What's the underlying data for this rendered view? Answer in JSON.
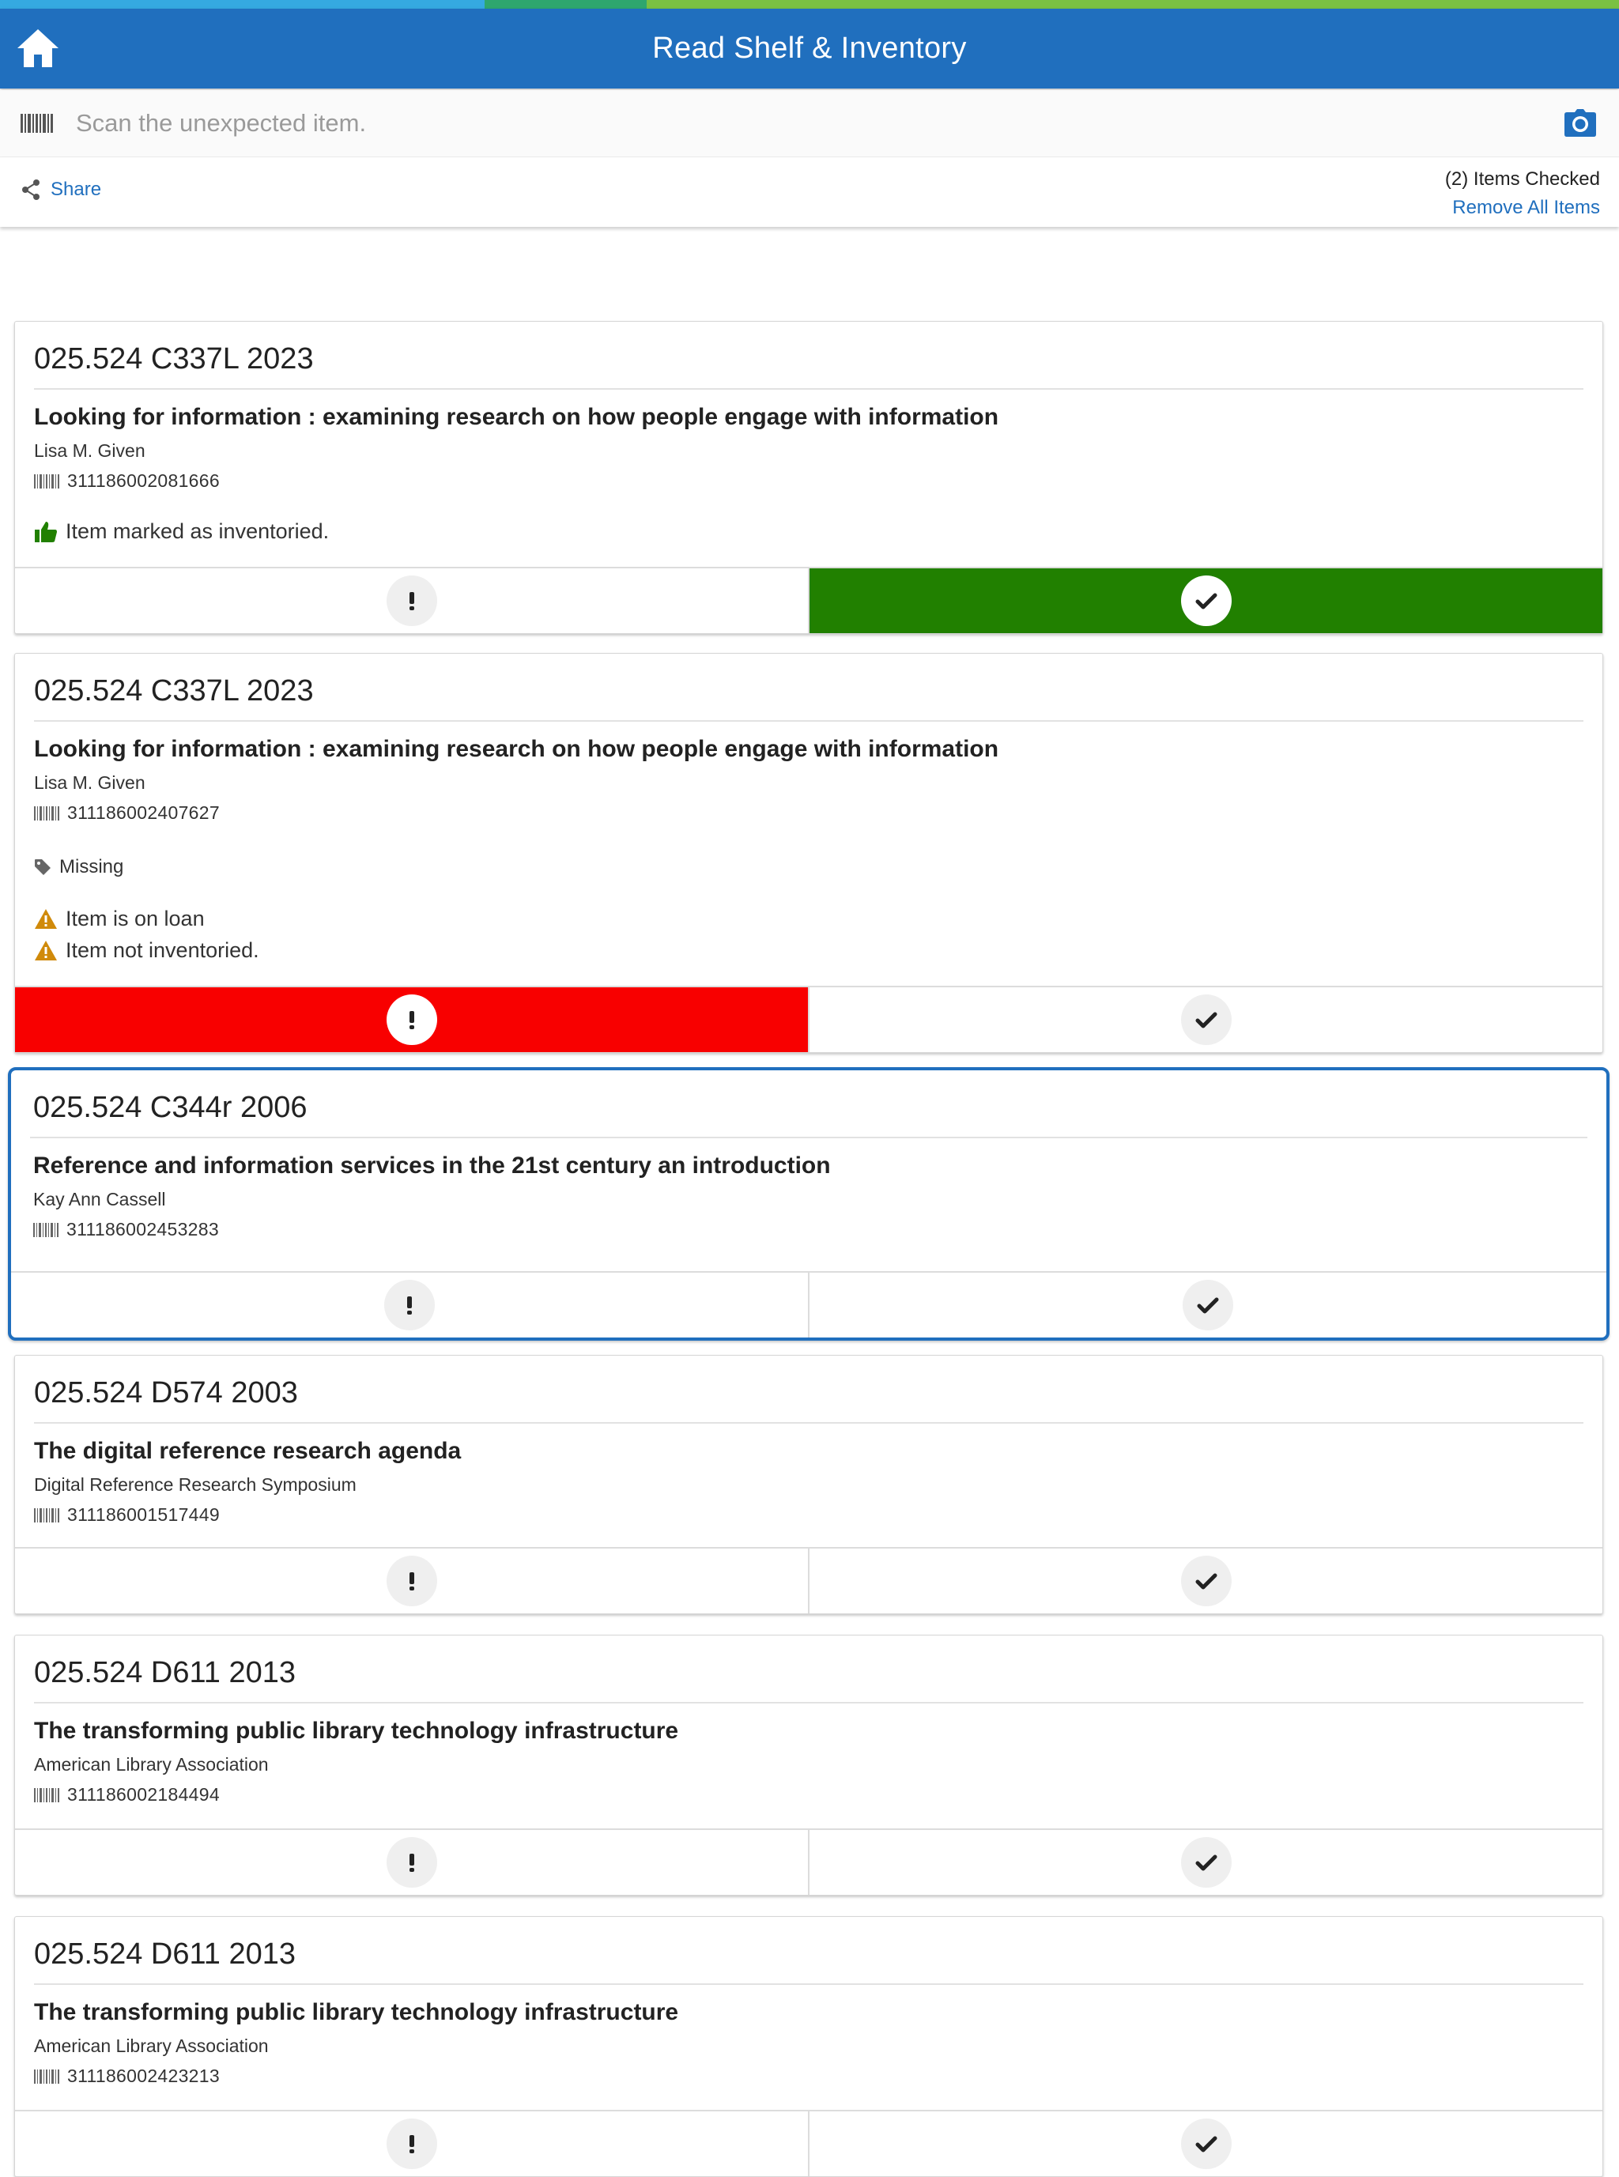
{
  "header": {
    "title": "Read Shelf & Inventory"
  },
  "scan": {
    "placeholder": "Scan the unexpected item."
  },
  "toolbar": {
    "share_label": "Share",
    "items_checked": "(2) Items Checked",
    "remove_all": "Remove All Items"
  },
  "colors": {
    "appbar": "#206fbe",
    "confirmed": "#218000",
    "problem": "#f80000",
    "warning": "#d08a0a"
  },
  "items": [
    {
      "call_number": "025.524 C337L 2023",
      "title": "Looking for information : examining research on how people engage with information",
      "author": "Lisa M. Given",
      "barcode": "311186002081666",
      "notes": [
        "Item marked as inventoried."
      ],
      "state": "inventoried"
    },
    {
      "call_number": "025.524 C337L 2023",
      "title": "Looking for information : examining research on how people engage with information",
      "author": "Lisa M. Given",
      "barcode": "311186002407627",
      "tag": "Missing",
      "warnings": [
        "Item is on loan",
        "Item not inventoried."
      ],
      "state": "problem"
    },
    {
      "call_number": "025.524 C344r 2006",
      "title": "Reference and information services in the 21st century an introduction",
      "author": "Kay Ann Cassell",
      "barcode": "311186002453283",
      "state": "selected"
    },
    {
      "call_number": "025.524 D574 2003",
      "title": "The digital reference research agenda",
      "author": "Digital Reference Research Symposium",
      "barcode": "311186001517449",
      "state": "pending"
    },
    {
      "call_number": "025.524 D611 2013",
      "title": "The transforming public library technology infrastructure",
      "author": "American Library Association",
      "barcode": "311186002184494",
      "state": "pending"
    },
    {
      "call_number": "025.524 D611 2013",
      "title": "The transforming public library technology infrastructure",
      "author": "American Library Association",
      "barcode": "311186002423213",
      "state": "pending"
    }
  ]
}
